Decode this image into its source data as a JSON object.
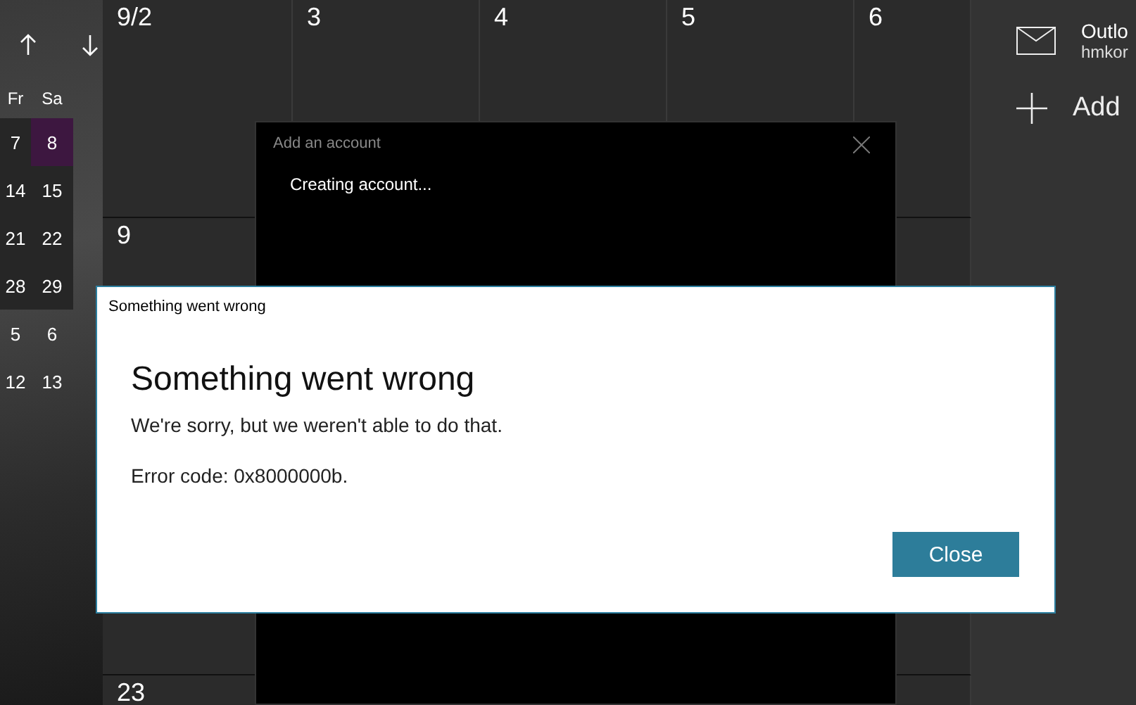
{
  "sidebar": {
    "weekdays": [
      "Fr",
      "Sa"
    ],
    "weeks": [
      {
        "in_month": true,
        "days": [
          {
            "label": "7",
            "selected": false
          },
          {
            "label": "8",
            "selected": true
          }
        ]
      },
      {
        "in_month": true,
        "days": [
          {
            "label": "14",
            "selected": false
          },
          {
            "label": "15",
            "selected": false
          }
        ]
      },
      {
        "in_month": true,
        "days": [
          {
            "label": "21",
            "selected": false
          },
          {
            "label": "22",
            "selected": false
          }
        ]
      },
      {
        "in_month": true,
        "days": [
          {
            "label": "28",
            "selected": false
          },
          {
            "label": "29",
            "selected": false
          }
        ]
      },
      {
        "in_month": false,
        "days": [
          {
            "label": "5",
            "selected": false
          },
          {
            "label": "6",
            "selected": false
          }
        ]
      },
      {
        "in_month": false,
        "days": [
          {
            "label": "12",
            "selected": false
          },
          {
            "label": "13",
            "selected": false
          }
        ]
      }
    ]
  },
  "calendar": {
    "rows": [
      {
        "cells": [
          "9/2",
          "3",
          "4",
          "5",
          "6"
        ]
      },
      {
        "cells": [
          "9"
        ]
      },
      {
        "cells": [
          "23"
        ]
      }
    ]
  },
  "accounts_panel": {
    "accounts": [
      {
        "name": "Outlo",
        "email": "hmkor"
      }
    ],
    "add_label": "Add"
  },
  "add_account_dialog": {
    "title": "Add an account",
    "status": "Creating account..."
  },
  "error_dialog": {
    "window_title": "Something went wrong",
    "heading": "Something went wrong",
    "message": "We're sorry, but we weren't able to do that.",
    "error_code": "Error code: 0x8000000b.",
    "buttons": [
      "Close"
    ]
  }
}
